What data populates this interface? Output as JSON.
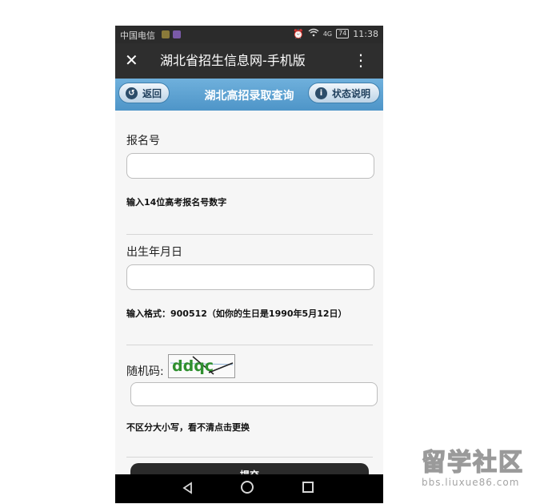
{
  "status_bar": {
    "carrier": "中国电信",
    "network": "4G",
    "battery": "74",
    "time": "11:38"
  },
  "app_bar": {
    "title": "湖北省招生信息网-手机版"
  },
  "sub_header": {
    "back_label": "返回",
    "title": "湖北高招录取查询",
    "status_label": "状态说明"
  },
  "form": {
    "exam_number": {
      "label": "报名号",
      "value": "",
      "hint": "输入14位高考报名号数字"
    },
    "birthday": {
      "label": "出生年月日",
      "value": "",
      "hint": "输入格式：900512（如你的生日是1990年5月12日）"
    },
    "captcha": {
      "label": "随机码:",
      "code": "ddqc",
      "value": "",
      "hint": "不区分大小写，看不清点击更换"
    },
    "submit_label": "提交"
  },
  "watermark": {
    "main": "留学社区",
    "sub": "bbs.liuxue86.com"
  },
  "icons": [
    "close-icon",
    "more-icon",
    "back-icon",
    "info-icon",
    "wifi-icon",
    "alarm-icon",
    "nav-back-icon",
    "nav-home-icon",
    "nav-recent-icon"
  ],
  "colors": {
    "app_bar": "#2e2e2e",
    "sub_header": "#5ea3d3",
    "captcha_green": "#2f8f2f"
  }
}
